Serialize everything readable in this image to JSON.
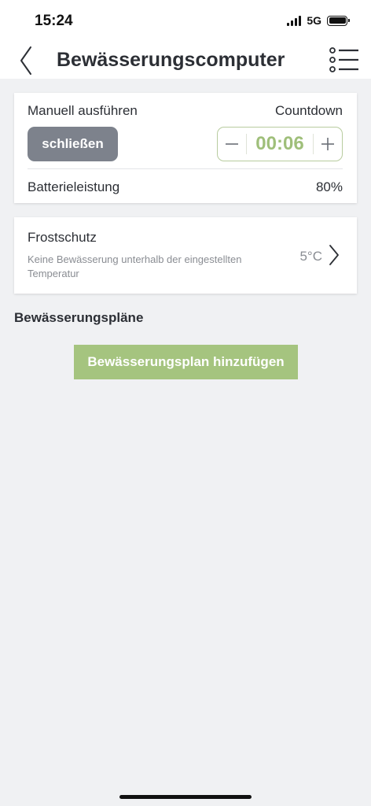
{
  "status": {
    "time": "15:24",
    "network": "5G"
  },
  "nav": {
    "title": "Bewässerungscomputer"
  },
  "manual": {
    "label": "Manuell ausführen",
    "countdown_label": "Countdown",
    "close_button": "schließen",
    "countdown_value": "00:06",
    "battery_label": "Batterieleistung",
    "battery_value": "80%"
  },
  "frost": {
    "title": "Frostschutz",
    "description": "Keine Bewässerung unterhalb der eingestellten Temperatur",
    "temperature": "5°C"
  },
  "plans": {
    "heading": "Bewässerungspläne",
    "add_button": "Bewässerungsplan hinzufügen"
  },
  "colors": {
    "accent_green": "#a5c47f",
    "stepper_text": "#9fbf7a",
    "close_button_bg": "#7d828c",
    "background": "#f0f1f3"
  },
  "icons": [
    "back-chevron-icon",
    "menu-list-icon",
    "minus-icon",
    "plus-icon",
    "chevron-right-icon"
  ]
}
